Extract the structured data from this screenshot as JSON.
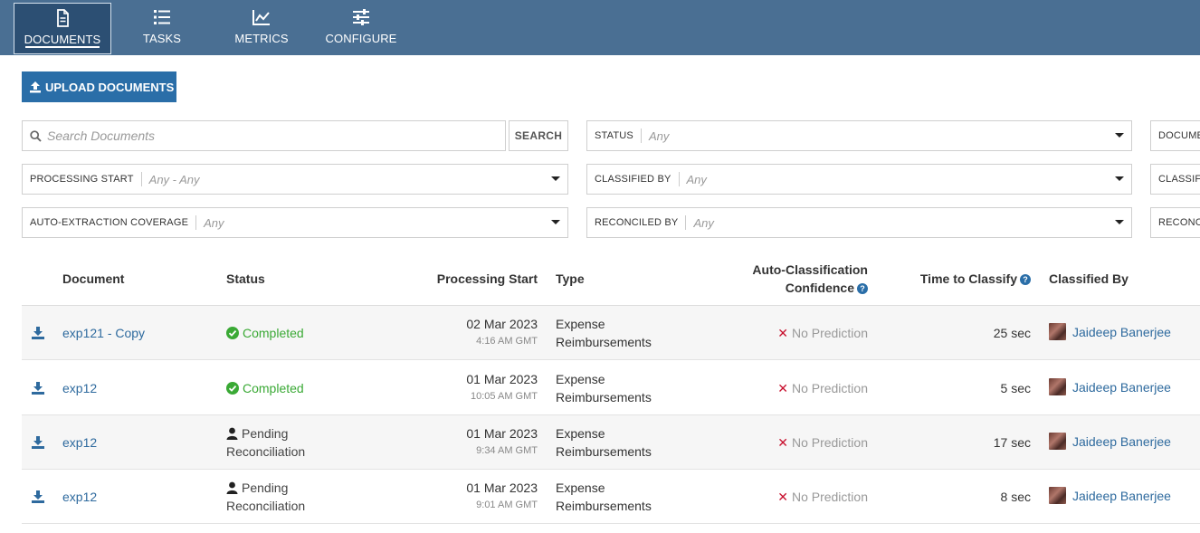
{
  "nav": {
    "items": [
      {
        "label": "DOCUMENTS",
        "icon": "document-icon",
        "active": true
      },
      {
        "label": "TASKS",
        "icon": "list-icon",
        "active": false
      },
      {
        "label": "METRICS",
        "icon": "chart-icon",
        "active": false
      },
      {
        "label": "CONFIGURE",
        "icon": "sliders-icon",
        "active": false
      }
    ]
  },
  "toolbar": {
    "upload_label": "UPLOAD DOCUMENTS"
  },
  "search": {
    "placeholder": "Search Documents",
    "button_label": "SEARCH"
  },
  "filters": {
    "status": {
      "label": "STATUS",
      "value": "Any"
    },
    "document_type": {
      "label": "DOCUME"
    },
    "processing_start": {
      "label": "PROCESSING START",
      "value": "Any - Any"
    },
    "classified_by": {
      "label": "CLASSIFIED BY",
      "value": "Any"
    },
    "classification": {
      "label": "CLASSIFI"
    },
    "auto_extraction": {
      "label": "AUTO-EXTRACTION COVERAGE",
      "value": "Any"
    },
    "reconciled_by": {
      "label": "RECONCILED BY",
      "value": "Any"
    },
    "reconciliation": {
      "label": "RECONC"
    }
  },
  "table": {
    "headers": {
      "document": "Document",
      "status": "Status",
      "processing_start": "Processing Start",
      "type": "Type",
      "confidence_line1": "Auto-Classification",
      "confidence_line2": "Confidence",
      "time_to_classify": "Time to Classify",
      "classified_by": "Classified By"
    },
    "help_glyph": "?",
    "rows": [
      {
        "document": "exp121 - Copy",
        "status_kind": "completed",
        "status1": "Completed",
        "status2": "",
        "date": "02 Mar 2023",
        "time": "4:16 AM GMT",
        "type1": "Expense",
        "type2": "Reimbursements",
        "prediction": "No Prediction",
        "classify_time": "25 sec",
        "classifier": "Jaideep Banerjee"
      },
      {
        "document": "exp12",
        "status_kind": "completed",
        "status1": "Completed",
        "status2": "",
        "date": "01 Mar 2023",
        "time": "10:05 AM GMT",
        "type1": "Expense",
        "type2": "Reimbursements",
        "prediction": "No Prediction",
        "classify_time": "5 sec",
        "classifier": "Jaideep Banerjee"
      },
      {
        "document": "exp12",
        "status_kind": "pending",
        "status1": "Pending",
        "status2": "Reconciliation",
        "date": "01 Mar 2023",
        "time": "9:34 AM GMT",
        "type1": "Expense",
        "type2": "Reimbursements",
        "prediction": "No Prediction",
        "classify_time": "17 sec",
        "classifier": "Jaideep Banerjee"
      },
      {
        "document": "exp12",
        "status_kind": "pending",
        "status1": "Pending",
        "status2": "Reconciliation",
        "date": "01 Mar 2023",
        "time": "9:01 AM GMT",
        "type1": "Expense",
        "type2": "Reimbursements",
        "prediction": "No Prediction",
        "classify_time": "8 sec",
        "classifier": "Jaideep Banerjee"
      }
    ],
    "x_glyph": "✕"
  },
  "colors": {
    "nav_bg": "#4a6f93",
    "nav_active": "#2c4f73",
    "accent": "#2a6ea8",
    "link": "#2e6a9e",
    "completed": "#3aa935",
    "no_prediction_x": "#c8102e"
  }
}
